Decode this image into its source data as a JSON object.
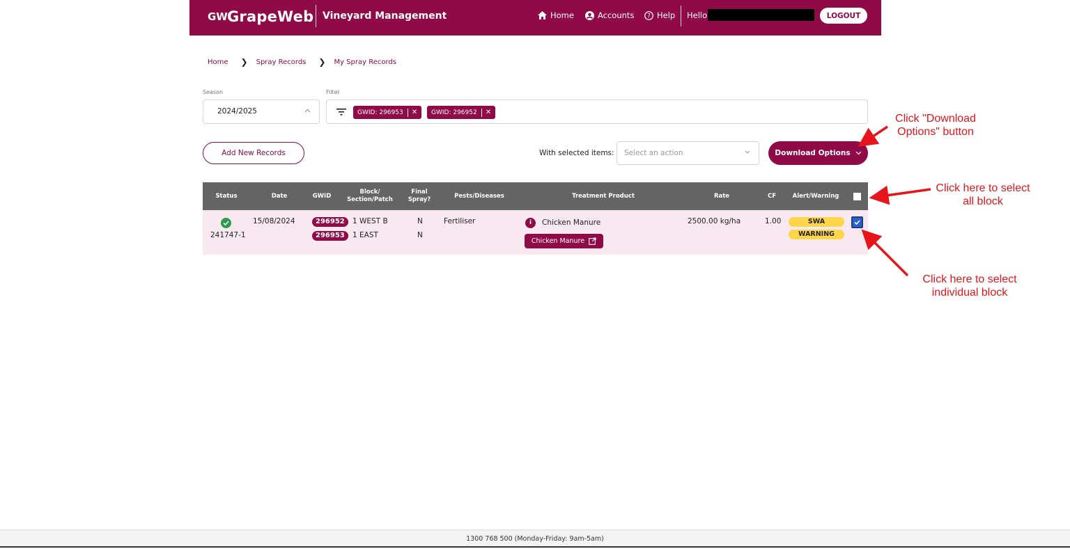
{
  "header": {
    "logo_mark": "GW",
    "logo_text": "GrapeWeb",
    "app_title": "Vineyard Management",
    "nav_home": "Home",
    "nav_accounts": "Accounts",
    "nav_help": "Help",
    "hello": "Hello,",
    "logout": "LOGOUT",
    "bg_color": "#8f0a46"
  },
  "breadcrumb": [
    "Home",
    "Spray Records",
    "My Spray Records"
  ],
  "season": {
    "label": "Season",
    "value": "2024/2025"
  },
  "filter": {
    "label": "Filter",
    "chips": [
      "GWID: 296953",
      "GWID: 296952"
    ]
  },
  "actions": {
    "add_new": "Add New Records",
    "with_selected": "With selected items:",
    "select_placeholder": "Select an action",
    "download": "Download Options"
  },
  "table": {
    "headers": {
      "status": "Status",
      "date": "Date",
      "gwid": "GWID",
      "block": "Block/\nSection/Patch",
      "final": "Final\nSpray?",
      "pests": "Pests/Diseases",
      "product": "Treatment Product",
      "rate": "Rate",
      "cf": "CF",
      "alert": "Alert/Warning"
    },
    "rows": [
      {
        "status": "complete",
        "record_id": "241747-1",
        "date": "15/08/2024",
        "gwids": [
          "296952",
          "296953"
        ],
        "blocks": [
          "1 WEST B",
          "1 EAST"
        ],
        "final_spray": [
          "N",
          "N"
        ],
        "pests": "Fertiliser",
        "product": "Chicken Manure",
        "product_button": "Chicken Manure",
        "rate": "2500.00 kg/ha",
        "cf": "1.00",
        "alerts": [
          "SWA",
          "WARNING"
        ],
        "checked": true
      }
    ]
  },
  "annotations": {
    "download": "Click \"Download\nOptions\" button",
    "select_all": "Click here to select\nall block",
    "select_one": "Click here to select\nindividual block",
    "color": "#e8141b"
  },
  "footer": "1300 768 500 (Monday-Friday: 9am-5am)"
}
